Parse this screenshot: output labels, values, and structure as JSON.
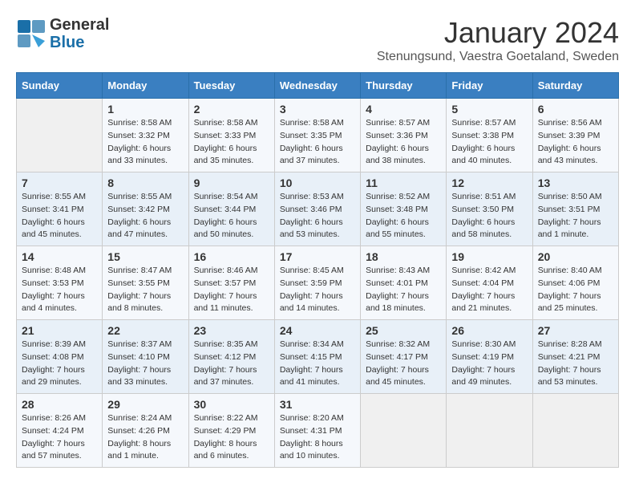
{
  "header": {
    "logo_line1": "General",
    "logo_line2": "Blue",
    "month_title": "January 2024",
    "subtitle": "Stenungsund, Vaestra Goetaland, Sweden"
  },
  "weekdays": [
    "Sunday",
    "Monday",
    "Tuesday",
    "Wednesday",
    "Thursday",
    "Friday",
    "Saturday"
  ],
  "weeks": [
    [
      {
        "day": "",
        "info": ""
      },
      {
        "day": "1",
        "info": "Sunrise: 8:58 AM\nSunset: 3:32 PM\nDaylight: 6 hours\nand 33 minutes."
      },
      {
        "day": "2",
        "info": "Sunrise: 8:58 AM\nSunset: 3:33 PM\nDaylight: 6 hours\nand 35 minutes."
      },
      {
        "day": "3",
        "info": "Sunrise: 8:58 AM\nSunset: 3:35 PM\nDaylight: 6 hours\nand 37 minutes."
      },
      {
        "day": "4",
        "info": "Sunrise: 8:57 AM\nSunset: 3:36 PM\nDaylight: 6 hours\nand 38 minutes."
      },
      {
        "day": "5",
        "info": "Sunrise: 8:57 AM\nSunset: 3:38 PM\nDaylight: 6 hours\nand 40 minutes."
      },
      {
        "day": "6",
        "info": "Sunrise: 8:56 AM\nSunset: 3:39 PM\nDaylight: 6 hours\nand 43 minutes."
      }
    ],
    [
      {
        "day": "7",
        "info": "Sunrise: 8:55 AM\nSunset: 3:41 PM\nDaylight: 6 hours\nand 45 minutes."
      },
      {
        "day": "8",
        "info": "Sunrise: 8:55 AM\nSunset: 3:42 PM\nDaylight: 6 hours\nand 47 minutes."
      },
      {
        "day": "9",
        "info": "Sunrise: 8:54 AM\nSunset: 3:44 PM\nDaylight: 6 hours\nand 50 minutes."
      },
      {
        "day": "10",
        "info": "Sunrise: 8:53 AM\nSunset: 3:46 PM\nDaylight: 6 hours\nand 53 minutes."
      },
      {
        "day": "11",
        "info": "Sunrise: 8:52 AM\nSunset: 3:48 PM\nDaylight: 6 hours\nand 55 minutes."
      },
      {
        "day": "12",
        "info": "Sunrise: 8:51 AM\nSunset: 3:50 PM\nDaylight: 6 hours\nand 58 minutes."
      },
      {
        "day": "13",
        "info": "Sunrise: 8:50 AM\nSunset: 3:51 PM\nDaylight: 7 hours\nand 1 minute."
      }
    ],
    [
      {
        "day": "14",
        "info": "Sunrise: 8:48 AM\nSunset: 3:53 PM\nDaylight: 7 hours\nand 4 minutes."
      },
      {
        "day": "15",
        "info": "Sunrise: 8:47 AM\nSunset: 3:55 PM\nDaylight: 7 hours\nand 8 minutes."
      },
      {
        "day": "16",
        "info": "Sunrise: 8:46 AM\nSunset: 3:57 PM\nDaylight: 7 hours\nand 11 minutes."
      },
      {
        "day": "17",
        "info": "Sunrise: 8:45 AM\nSunset: 3:59 PM\nDaylight: 7 hours\nand 14 minutes."
      },
      {
        "day": "18",
        "info": "Sunrise: 8:43 AM\nSunset: 4:01 PM\nDaylight: 7 hours\nand 18 minutes."
      },
      {
        "day": "19",
        "info": "Sunrise: 8:42 AM\nSunset: 4:04 PM\nDaylight: 7 hours\nand 21 minutes."
      },
      {
        "day": "20",
        "info": "Sunrise: 8:40 AM\nSunset: 4:06 PM\nDaylight: 7 hours\nand 25 minutes."
      }
    ],
    [
      {
        "day": "21",
        "info": "Sunrise: 8:39 AM\nSunset: 4:08 PM\nDaylight: 7 hours\nand 29 minutes."
      },
      {
        "day": "22",
        "info": "Sunrise: 8:37 AM\nSunset: 4:10 PM\nDaylight: 7 hours\nand 33 minutes."
      },
      {
        "day": "23",
        "info": "Sunrise: 8:35 AM\nSunset: 4:12 PM\nDaylight: 7 hours\nand 37 minutes."
      },
      {
        "day": "24",
        "info": "Sunrise: 8:34 AM\nSunset: 4:15 PM\nDaylight: 7 hours\nand 41 minutes."
      },
      {
        "day": "25",
        "info": "Sunrise: 8:32 AM\nSunset: 4:17 PM\nDaylight: 7 hours\nand 45 minutes."
      },
      {
        "day": "26",
        "info": "Sunrise: 8:30 AM\nSunset: 4:19 PM\nDaylight: 7 hours\nand 49 minutes."
      },
      {
        "day": "27",
        "info": "Sunrise: 8:28 AM\nSunset: 4:21 PM\nDaylight: 7 hours\nand 53 minutes."
      }
    ],
    [
      {
        "day": "28",
        "info": "Sunrise: 8:26 AM\nSunset: 4:24 PM\nDaylight: 7 hours\nand 57 minutes."
      },
      {
        "day": "29",
        "info": "Sunrise: 8:24 AM\nSunset: 4:26 PM\nDaylight: 8 hours\nand 1 minute."
      },
      {
        "day": "30",
        "info": "Sunrise: 8:22 AM\nSunset: 4:29 PM\nDaylight: 8 hours\nand 6 minutes."
      },
      {
        "day": "31",
        "info": "Sunrise: 8:20 AM\nSunset: 4:31 PM\nDaylight: 8 hours\nand 10 minutes."
      },
      {
        "day": "",
        "info": ""
      },
      {
        "day": "",
        "info": ""
      },
      {
        "day": "",
        "info": ""
      }
    ]
  ]
}
